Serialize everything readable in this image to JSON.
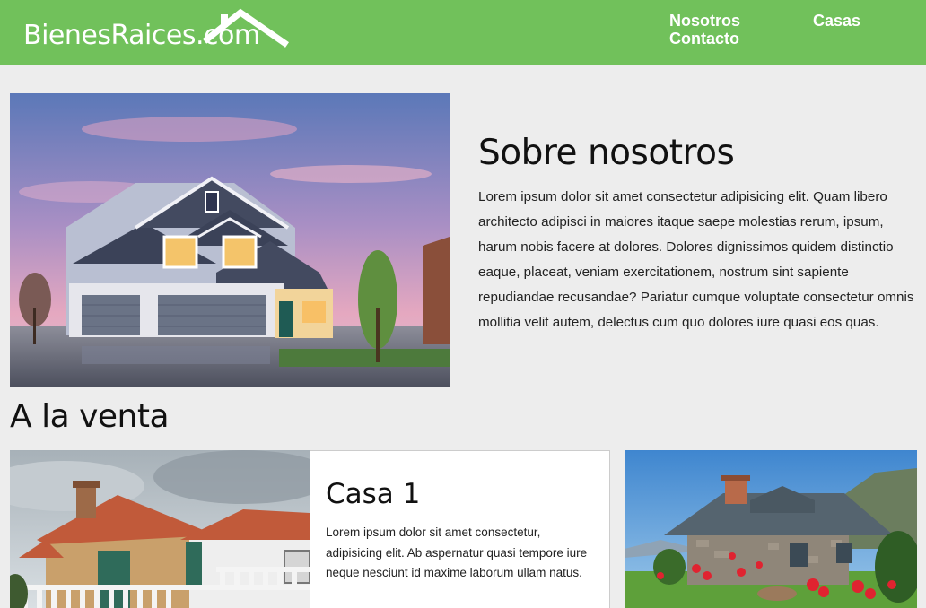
{
  "header": {
    "logo_text": "BienesRaices.com",
    "nav": {
      "nosotros": "Nosotros",
      "contacto": "Contacto",
      "casas": "Casas"
    },
    "bg_color": "#71c15b"
  },
  "about": {
    "title": "Sobre nosotros",
    "text": "Lorem ipsum dolor sit amet consectetur adipisicing elit. Quam libero architecto adipisci in maiores itaque saepe molestias rerum, ipsum, harum nobis facere at dolores. Dolores dignissimos quidem distinctio eaque, placeat, veniam exercitationem, nostrum sint sapiente repudiandae recusandae? Pariatur cumque voluptate consectetur omnis mollitia velit autem, delectus cum quo dolores iure quasi eos quas."
  },
  "sale": {
    "title": "A la venta",
    "card1": {
      "title": "Casa 1",
      "text": "Lorem ipsum dolor sit amet consectetur, adipisicing elit. Ab aspernatur quasi tempore iure neque nesciunt id maxime laborum ullam natus."
    }
  }
}
